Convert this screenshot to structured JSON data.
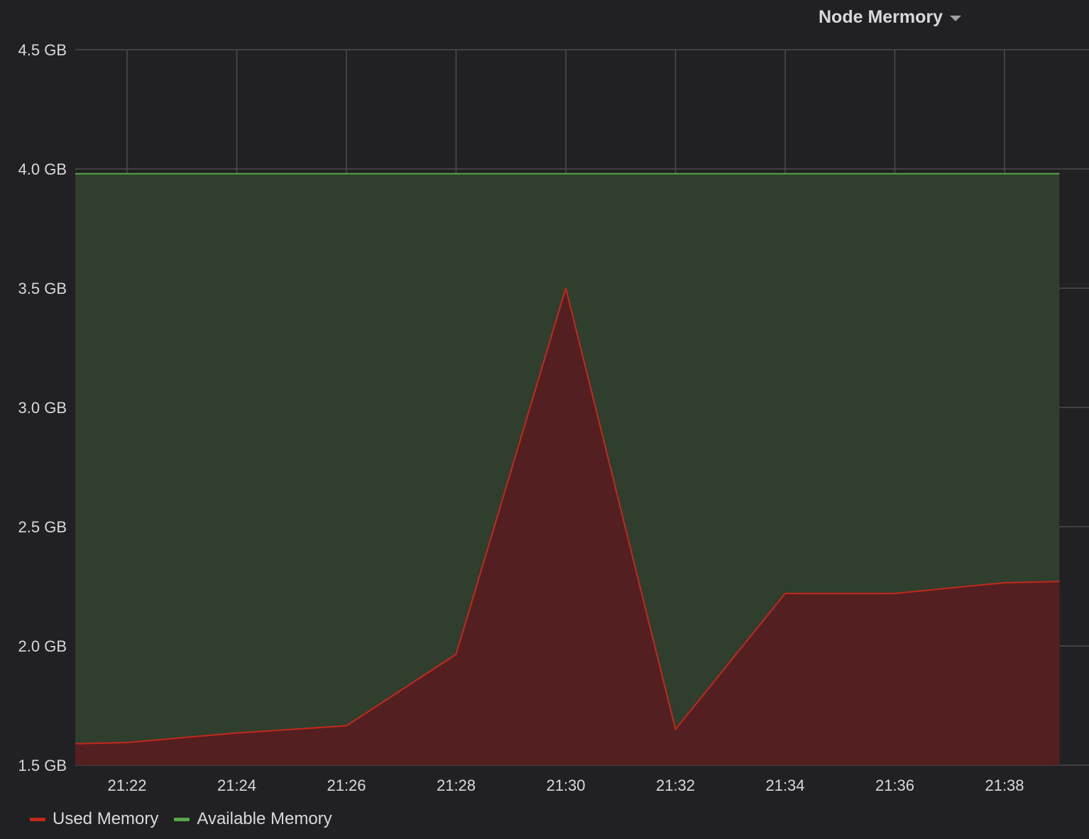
{
  "panel": {
    "title": "Node Mermory"
  },
  "colors": {
    "background": "#212124",
    "used": "#c4281b",
    "used_fill": "#531f20",
    "available": "#56a64b",
    "available_fill": "#303e2e",
    "grid": "#4a4c50",
    "text": "#d8d9da"
  },
  "chart_data": {
    "type": "area",
    "x": [
      "21:21",
      "21:22",
      "21:24",
      "21:26",
      "21:28",
      "21:30",
      "21:32",
      "21:34",
      "21:36",
      "21:38",
      "21:39"
    ],
    "x_tick_labels": [
      "21:22",
      "21:24",
      "21:26",
      "21:28",
      "21:30",
      "21:32",
      "21:34",
      "21:36",
      "21:38"
    ],
    "y_tick_labels": [
      "4.5 GB",
      "4.0 GB",
      "3.5 GB",
      "3.0 GB",
      "2.5 GB",
      "2.0 GB",
      "1.5 GB"
    ],
    "y_ticks": [
      4.5,
      4.0,
      3.5,
      3.0,
      2.5,
      2.0,
      1.5
    ],
    "ylim": [
      1.5,
      4.5
    ],
    "x_unit_minutes_start": "21:21",
    "series": [
      {
        "name": "Used Memory",
        "color": "#c4281b",
        "values": [
          1.59,
          1.595,
          1.635,
          1.665,
          1.965,
          3.5,
          1.65,
          2.22,
          2.22,
          2.265,
          2.27
        ]
      },
      {
        "name": "Available Memory",
        "color": "#56a64b",
        "values": [
          3.98,
          3.98,
          3.98,
          3.98,
          3.98,
          3.98,
          3.98,
          3.98,
          3.98,
          3.98,
          3.98
        ]
      }
    ],
    "grid": true,
    "legend_position": "bottom-left",
    "stacked": false
  },
  "legend": {
    "items": [
      {
        "label": "Used Memory",
        "color": "#c4281b"
      },
      {
        "label": "Available Memory",
        "color": "#56a64b"
      }
    ]
  }
}
